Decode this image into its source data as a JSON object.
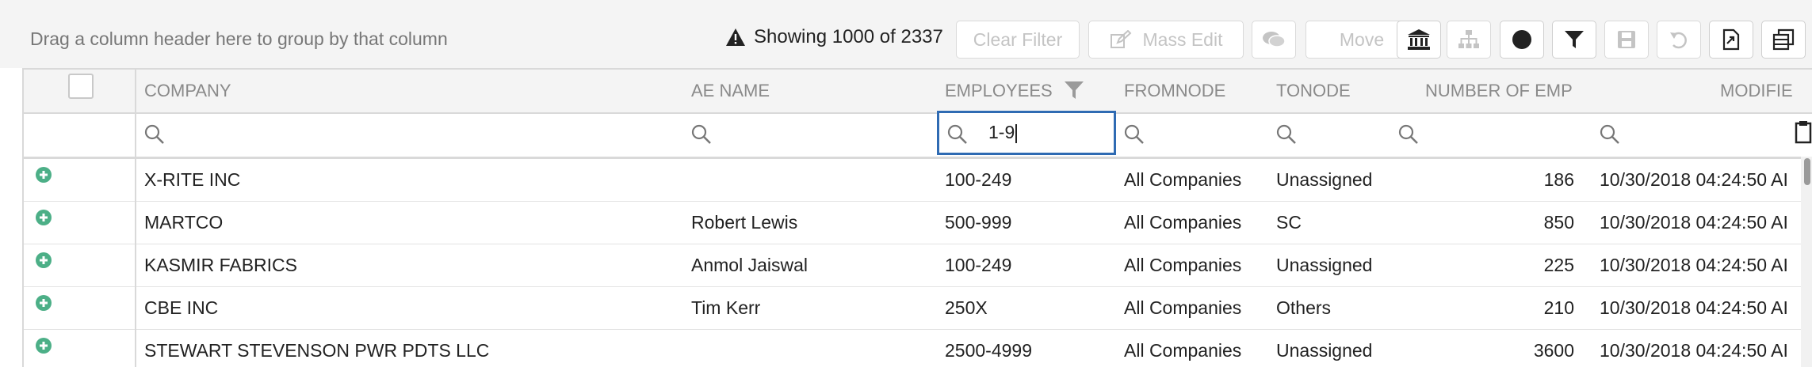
{
  "toolbar": {
    "group_hint": "Drag a column header here to group by that column",
    "status": "Showing 1000 of 2337",
    "clear_filter": "Clear Filter",
    "mass_edit": "Mass Edit",
    "move": "Move"
  },
  "columns": [
    "COMPANY",
    "AE NAME",
    "EMPLOYEES",
    "FROMNODE",
    "TONODE",
    "NUMBER OF EMP",
    "MODIFIE"
  ],
  "filter": {
    "employees_value": "1-9"
  },
  "rows": [
    {
      "company": "X-RITE INC",
      "ae": "",
      "employees": "100-249",
      "from": "All Companies",
      "to": "Unassigned",
      "num": "186",
      "modified": "10/30/2018 04:24:50 AI"
    },
    {
      "company": "MARTCO",
      "ae": "Robert Lewis",
      "employees": "500-999",
      "from": "All Companies",
      "to": "SC",
      "num": "850",
      "modified": "10/30/2018 04:24:50 AI"
    },
    {
      "company": "KASMIR FABRICS",
      "ae": "Anmol Jaiswal",
      "employees": "100-249",
      "from": "All Companies",
      "to": "Unassigned",
      "num": "225",
      "modified": "10/30/2018 04:24:50 AI"
    },
    {
      "company": "CBE INC",
      "ae": "Tim Kerr",
      "employees": "250X",
      "from": "All Companies",
      "to": "Others",
      "num": "210",
      "modified": "10/30/2018 04:24:50 AI"
    },
    {
      "company": "STEWART STEVENSON PWR PDTS LLC",
      "ae": "",
      "employees": "2500-4999",
      "from": "All Companies",
      "to": "Unassigned",
      "num": "3600",
      "modified": "10/30/2018 04:24:50 AI"
    }
  ],
  "colors": {
    "accent": "#2f6bb3",
    "add_icon": "#4caf87"
  }
}
